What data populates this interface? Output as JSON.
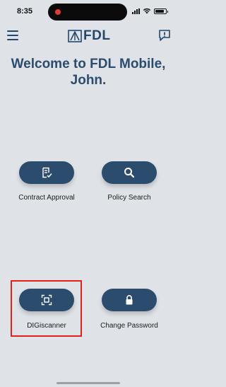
{
  "status_bar": {
    "time": "8:35",
    "battery_level": 0.85
  },
  "header": {
    "logo_text": "FDL",
    "icons": [
      "menu-icon",
      "logo-icon",
      "feedback-icon"
    ]
  },
  "welcome": {
    "line1": "Welcome to FDL Mobile,",
    "line2": "John."
  },
  "actions": [
    {
      "label": "Contract Approval",
      "icon": "contract-approval-icon"
    },
    {
      "label": "Policy Search",
      "icon": "search-icon"
    },
    {
      "label": "DIGiscanner",
      "icon": "scan-icon"
    },
    {
      "label": "Change Password",
      "icon": "lock-icon"
    }
  ],
  "colors": {
    "primary": "#2c4c6e",
    "background": "#dfe3e8",
    "highlight": "#e2231a"
  }
}
